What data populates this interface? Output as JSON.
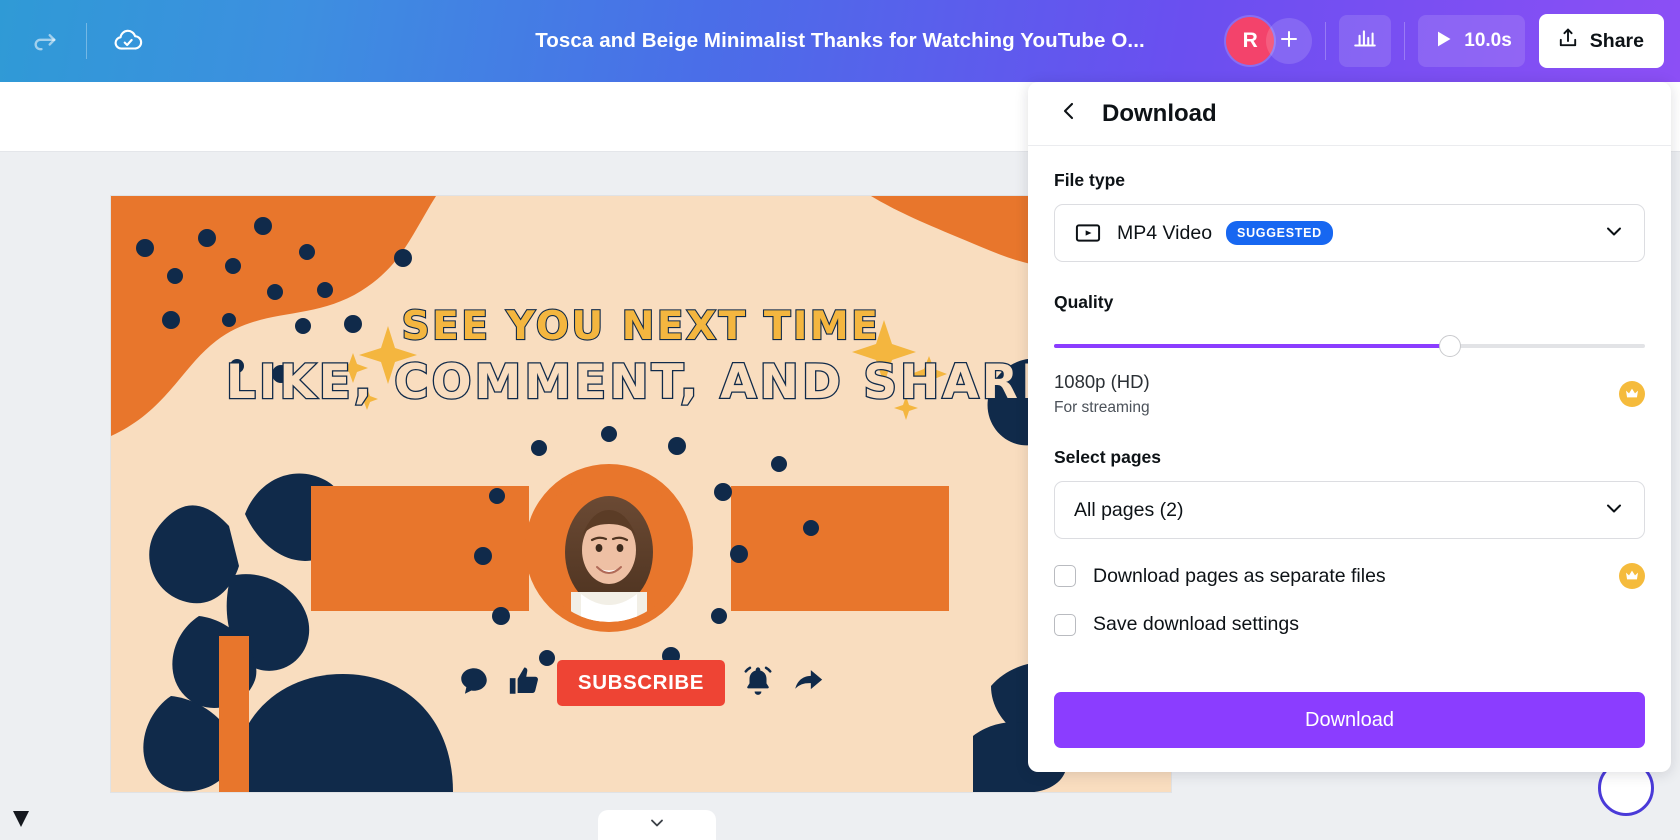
{
  "header": {
    "redo_icon": "redo-icon",
    "saved_icon": "cloud-check-icon",
    "title": "Tosca and Beige Minimalist Thanks for Watching YouTube O...",
    "avatar_initial": "R",
    "add_collaborator_icon": "plus-icon",
    "audio_icon": "audio-bars-icon",
    "play_icon": "play-icon",
    "duration": "10.0s",
    "share_icon": "share-upload-icon",
    "share_label": "Share",
    "gradient_from": "#2f9ad6",
    "gradient_to": "#8c4ff5"
  },
  "design": {
    "headline_1": "SEE YOU NEXT TIME",
    "headline_2": "LIKE, COMMENT, AND SHARE",
    "subscribe_label": "SUBSCRIBE",
    "colors": {
      "background": "#f9ddbf",
      "navy": "#102a4a",
      "orange": "#e8762c",
      "gold": "#f4b63f",
      "subscribe_red": "#ee4434"
    },
    "icons": [
      "comment-bubble-icon",
      "thumbs-up-icon",
      "bell-icon",
      "share-arrow-icon"
    ]
  },
  "panel": {
    "back_icon": "chevron-left-icon",
    "title": "Download",
    "file_type": {
      "label": "File type",
      "icon": "mp4-video-icon",
      "value": "MP4 Video",
      "badge": "SUGGESTED",
      "badge_color": "#1767f1",
      "chevron_icon": "chevron-down-icon"
    },
    "quality": {
      "label": "Quality",
      "value": "1080p (HD)",
      "description": "For streaming",
      "slider_percent": 67,
      "slider_color": "#8b3dff",
      "pro_icon": "crown-icon"
    },
    "select_pages": {
      "label": "Select pages",
      "value": "All pages (2)",
      "chevron_icon": "chevron-down-icon"
    },
    "checkboxes": [
      {
        "label": "Download pages as separate files",
        "checked": false,
        "pro": true
      },
      {
        "label": "Save download settings",
        "checked": false,
        "pro": false
      }
    ],
    "download_button": "Download",
    "download_button_color": "#8b3dff"
  },
  "workspace": {
    "gem_icon": "gem-icon",
    "page_toggle_icon": "chevron-down-icon",
    "help_icon": "help-circle-icon"
  }
}
